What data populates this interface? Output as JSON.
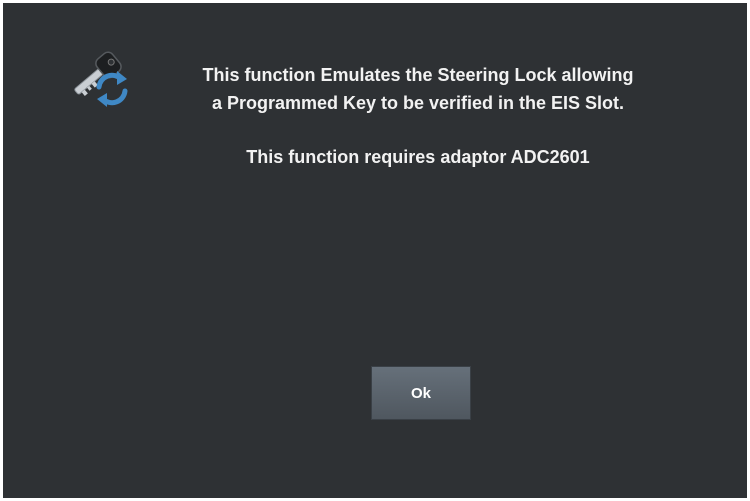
{
  "dialog": {
    "icon": "key-sync-icon",
    "message_line1": "This function Emulates the Steering Lock allowing",
    "message_line2": "a Programmed Key to be verified in the EIS Slot.",
    "requirement": "This function requires adaptor ADC2601",
    "ok_label": "Ok"
  },
  "colors": {
    "background": "#2e3134",
    "text": "#f2f2f2",
    "button": "#5b636b",
    "icon_refresh": "#3f88c5"
  }
}
